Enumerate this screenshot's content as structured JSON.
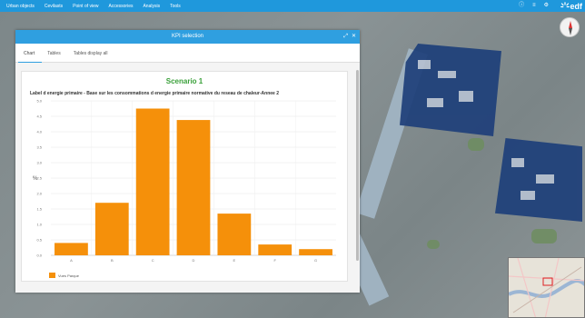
{
  "nav": {
    "items": [
      "Urban objects",
      "Cevilasts",
      "Point of view",
      "Accessories",
      "Analysis",
      "Tools"
    ]
  },
  "brand": {
    "name": "edf"
  },
  "panel": {
    "title": "KPI selection",
    "tabs": [
      "Chart",
      "Tables",
      "Tables display all"
    ],
    "active_tab": "Chart"
  },
  "colors": {
    "bar": "#f5900a",
    "header": "#2f9fe0",
    "district": "#1e3f7a",
    "scenario": "#3aa03a"
  },
  "chart_data": {
    "type": "bar",
    "title": "Scenario 1",
    "subtitle": "Label d energie primaire - Base sur les consommations d energie primaire normative du reseau de chaleur-Annee 2",
    "ylabel": "%",
    "xlabel": "",
    "categories": [
      "A",
      "B",
      "C",
      "D",
      "E",
      "F",
      "G"
    ],
    "values": [
      0.4,
      1.7,
      4.75,
      4.38,
      1.35,
      0.35,
      0.2
    ],
    "ylim": [
      0,
      5.0
    ],
    "yticks": [
      "0.0",
      "0.5",
      "1.0",
      "1.5",
      "2.0",
      "2.5",
      "3.0",
      "3.5",
      "4.0",
      "4.5",
      "5.0"
    ],
    "series": [
      {
        "name": "Vues Parque",
        "values": [
          0.4,
          1.7,
          4.75,
          4.38,
          1.35,
          0.35,
          0.2
        ]
      }
    ],
    "grid": true,
    "legend_position": "bottom-left"
  }
}
